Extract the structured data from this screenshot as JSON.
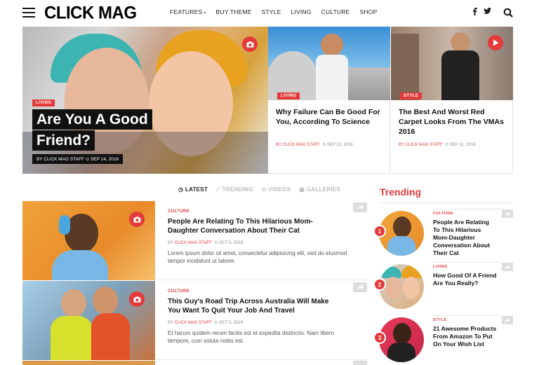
{
  "header": {
    "logo": "CLICK MAG",
    "nav": [
      "FEATURES",
      "BUY THEME",
      "STYLE",
      "LIVING",
      "CULTURE",
      "SHOP"
    ],
    "features_caret": "▾",
    "social": {
      "facebook": "f",
      "twitter": "🐦"
    }
  },
  "hero": {
    "main": {
      "tag": "LIVING",
      "title_line1": "Are You A Good",
      "title_line2": "Friend?",
      "meta": "BY CLICK MAG STAFF   ⊙ SEP 14, 2016"
    },
    "cards": [
      {
        "tag": "LIVING",
        "title": "Why Failure Can Be Good For You, According To Science",
        "author": "BY CLICK MAG STAFF",
        "date": "⊙ SEP 12, 2016"
      },
      {
        "tag": "STYLE",
        "title": "The Best And Worst Red Carpet Looks From The VMAs 2016",
        "author": "BY CLICK MAG STAFF",
        "date": "⊙ SEP 11, 2016"
      }
    ]
  },
  "tabs": [
    {
      "icon": "clock-icon",
      "label": "LATEST"
    },
    {
      "icon": "chart-icon",
      "label": "TRENDING"
    },
    {
      "icon": "video-icon",
      "label": "VIDEOS"
    },
    {
      "icon": "camera-icon",
      "label": "GALLERIES"
    }
  ],
  "feed": [
    {
      "category": "CULTURE",
      "title": "People Are Relating To This Hilarious Mom-Daughter Conversation About Their Cat",
      "by": "BY",
      "author": "CLICK MAG STAFF",
      "date": "⊙ OCT 6, 2016",
      "excerpt": "Lorem ipsum dolor sit amet, consectetur adipisicing elit, sed do eiusmod tempor incididunt ut labore."
    },
    {
      "category": "CULTURE",
      "title": "This Guy's Road Trip Across Australia Will Make You Want To Quit Your Job And Travel",
      "by": "BY",
      "author": "CLICK MAG STAFF",
      "date": "⊙ OCT 5, 2016",
      "excerpt": "Et harum quidem rerum facilis est et expedita distinctio. Nam libero tempore, cum soluta nobis est."
    }
  ],
  "trending": {
    "heading": "Trending",
    "items": [
      {
        "rank": "1",
        "category": "CULTURE",
        "title": "People Are Relating To This Hilarious Mom-Daughter Conversation About Their Cat"
      },
      {
        "rank": "2",
        "category": "LIVING",
        "title": "How Good Of A Friend Are You Really?"
      },
      {
        "rank": "3",
        "category": "STYLE",
        "title": "21 Awesome Products From Amazon To Put On Your Wish List"
      }
    ]
  },
  "colors": {
    "accent": "#e43a3a",
    "text": "#111111",
    "muted": "#888888"
  }
}
